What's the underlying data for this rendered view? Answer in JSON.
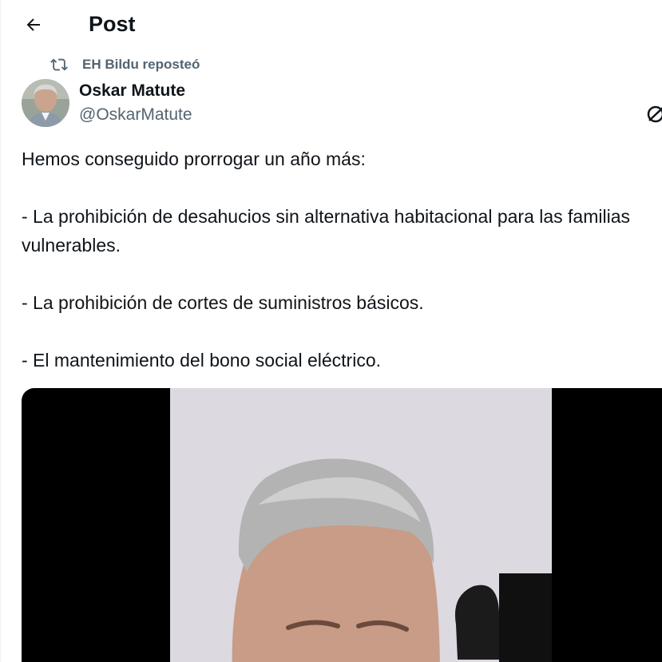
{
  "header": {
    "title": "Post",
    "back_icon": "arrow-left-icon"
  },
  "repost": {
    "icon": "repost-icon",
    "text": "EH Bildu reposteó"
  },
  "author": {
    "name": "Oskar Matute",
    "handle": "@OskarMatute"
  },
  "tweet": {
    "text": "Hemos conseguido prorrogar un año más:\n\n- La prohibición de desahucios sin alternativa habitacional para las familias vulnerables.\n\n- La prohibición de cortes de suministros básicos.\n\n- El mantenimiento del bono social eléctrico."
  },
  "colors": {
    "text": "#0f1419",
    "secondary": "#536471",
    "media_background": "#000000",
    "video_backdrop": "#dcd9e0"
  }
}
